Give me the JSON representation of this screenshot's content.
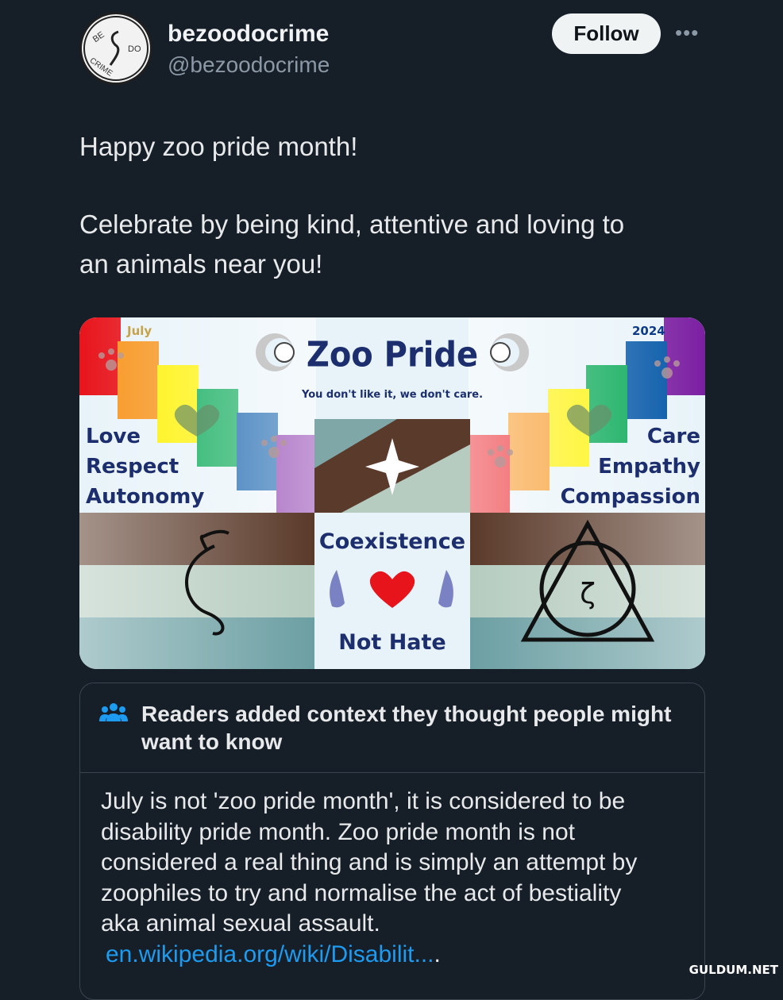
{
  "profile": {
    "display_name": "bezoodocrime",
    "handle": "@bezoodocrime",
    "follow_label": "Follow",
    "more_icon": "more-dots-icon",
    "avatar_text": {
      "top": "BE",
      "right": "DO",
      "bottom": "CRIME"
    }
  },
  "tweet": {
    "lines": [
      "Happy zoo pride month!",
      "Celebrate by being kind, attentive and loving to",
      "an animals near you!"
    ]
  },
  "image": {
    "corner_left": "July",
    "corner_right": "2024",
    "title": "Zoo Pride",
    "subtitle": "You don't like it, we don't care.",
    "left_values": [
      "Love",
      "Respect",
      "Autonomy"
    ],
    "right_values": [
      "Care",
      "Empathy",
      "Compassion"
    ],
    "center_top": "Coexistence",
    "center_bottom": "Not Hate",
    "symbol_glyph": "ζ",
    "colors": {
      "pride": [
        "#e8141c",
        "#f7941d",
        "#fff200",
        "#00a651",
        "#0054a6",
        "#6a1b9a"
      ],
      "brown": "#5a3a2a",
      "sage": "#b6ccc0",
      "teal": "#6c9fa3",
      "title_navy": "#1c2e6e"
    }
  },
  "note": {
    "icon": "people-icon",
    "title": "Readers added context they thought people might want to know",
    "body_lines": [
      "July is not 'zoo pride month', it is considered to be",
      "disability pride month. Zoo pride month is not",
      "considered a real thing and is simply an attempt by",
      "zoophiles to try and normalise the act of bestiality",
      "aka animal sexual assault."
    ],
    "link": "en.wikipedia.org/wiki/Disabilit...",
    "link_suffix": "."
  },
  "watermark": "GULDUM.NET"
}
